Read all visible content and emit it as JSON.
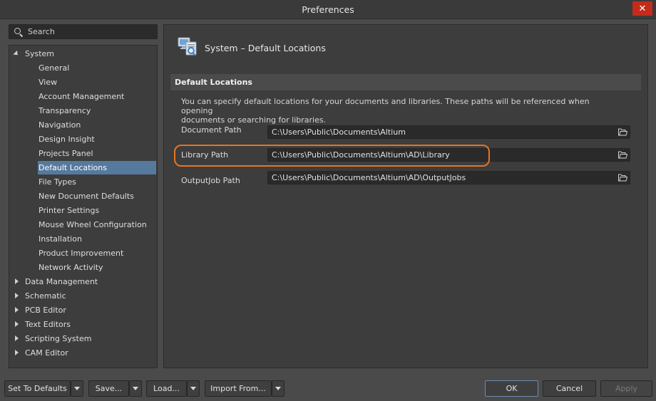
{
  "window": {
    "title": "Preferences",
    "close_label": "✕"
  },
  "search": {
    "placeholder": "Search"
  },
  "tree": {
    "items": [
      {
        "label": "System",
        "level": 0,
        "state": "expanded"
      },
      {
        "label": "General",
        "level": 1
      },
      {
        "label": "View",
        "level": 1
      },
      {
        "label": "Account Management",
        "level": 1
      },
      {
        "label": "Transparency",
        "level": 1
      },
      {
        "label": "Navigation",
        "level": 1
      },
      {
        "label": "Design Insight",
        "level": 1
      },
      {
        "label": "Projects Panel",
        "level": 1
      },
      {
        "label": "Default Locations",
        "level": 1,
        "selected": true
      },
      {
        "label": "File Types",
        "level": 1
      },
      {
        "label": "New Document Defaults",
        "level": 1
      },
      {
        "label": "Printer Settings",
        "level": 1
      },
      {
        "label": "Mouse Wheel Configuration",
        "level": 1
      },
      {
        "label": "Installation",
        "level": 1
      },
      {
        "label": "Product Improvement",
        "level": 1
      },
      {
        "label": "Network Activity",
        "level": 1
      },
      {
        "label": "Data Management",
        "level": 0,
        "state": "collapsed"
      },
      {
        "label": "Schematic",
        "level": 0,
        "state": "collapsed"
      },
      {
        "label": "PCB Editor",
        "level": 0,
        "state": "collapsed"
      },
      {
        "label": "Text Editors",
        "level": 0,
        "state": "collapsed"
      },
      {
        "label": "Scripting System",
        "level": 0,
        "state": "collapsed"
      },
      {
        "label": "CAM Editor",
        "level": 0,
        "state": "collapsed"
      }
    ]
  },
  "page": {
    "title": "System – Default Locations",
    "section": "Default Locations",
    "description_line1": "You can specify default locations for your documents and libraries. These paths will be referenced when opening",
    "description_line2": "documents or searching for libraries.",
    "fields": {
      "document": {
        "label": "Document Path",
        "value": "C:\\Users\\Public\\Documents\\Altium"
      },
      "library": {
        "label": "Library Path",
        "value": "C:\\Users\\Public\\Documents\\Altium\\AD\\Library"
      },
      "outputjob": {
        "label": "OutputJob Path",
        "value": "C:\\Users\\Public\\Documents\\Altium\\AD\\OutputJobs"
      }
    }
  },
  "buttons": {
    "set_defaults": "Set To Defaults",
    "save": "Save...",
    "load": "Load...",
    "import_from": "Import From...",
    "ok": "OK",
    "cancel": "Cancel",
    "apply": "Apply"
  },
  "colors": {
    "selection": "#56799e",
    "highlight_ring": "#e8741e",
    "close_button": "#c42b1c"
  }
}
